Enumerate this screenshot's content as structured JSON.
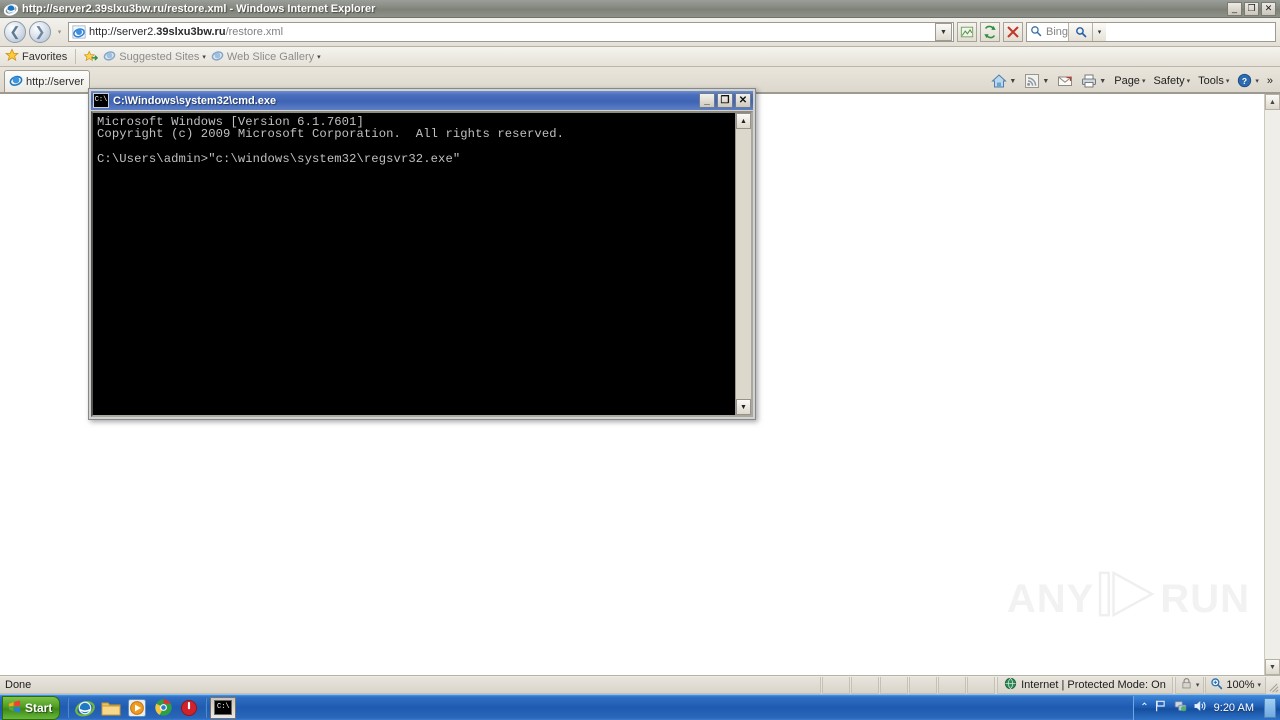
{
  "ie": {
    "window_title": "http://server2.39slxu3bw.ru/restore.xml - Windows Internet Explorer",
    "titlebar_buttons": {
      "minimize": "_",
      "restore": "❐",
      "close": "✕"
    },
    "address": {
      "url_prefix": "http://server2.",
      "url_host": "39slxu3bw.ru",
      "url_path": "/restore.xml",
      "full_url": "http://server2.39slxu3bw.ru/restore.xml"
    },
    "nav": {
      "back": "back-arrow",
      "forward": "forward-arrow",
      "recent_pages": "▾",
      "compatibility": "compatibility-view",
      "refresh": "refresh",
      "stop": "stop"
    },
    "search": {
      "placeholder": "Bing",
      "go_label": "Search",
      "dropdown": "▾"
    },
    "favorites_bar": {
      "favorites_label": "Favorites",
      "items": [
        {
          "label": "Suggested Sites",
          "caret": "▾"
        },
        {
          "label": "Web Slice Gallery",
          "caret": "▾"
        }
      ]
    },
    "tabs": [
      {
        "label": "http://server"
      }
    ],
    "command_bar": {
      "home": "home-icon",
      "feeds": "rss-icon",
      "mail": "mail-icon",
      "print": "print-icon",
      "items": [
        {
          "label": "Page",
          "caret": "▾"
        },
        {
          "label": "Safety",
          "caret": "▾"
        },
        {
          "label": "Tools",
          "caret": "▾"
        },
        {
          "label": "",
          "caret": "▾"
        }
      ],
      "overflow": "»"
    },
    "status_bar": {
      "text": "Done",
      "zone": "Internet | Protected Mode: On",
      "zoom": "100%",
      "zoom_caret": "▾",
      "lock_caret": "▾"
    },
    "watermark": {
      "left": "ANY",
      "right": "RUN"
    }
  },
  "cmd": {
    "title": "C:\\Windows\\system32\\cmd.exe",
    "icon_label": "C:\\",
    "buttons": {
      "minimize": "_",
      "maximize": "❐",
      "close": "✕"
    },
    "console_text": "Microsoft Windows [Version 6.1.7601]\nCopyright (c) 2009 Microsoft Corporation.  All rights reserved.\n\nC:\\Users\\admin>\"c:\\windows\\system32\\regsvr32.exe\"",
    "scroll_up": "▲",
    "scroll_down": "▼"
  },
  "taskbar": {
    "start_label": "Start",
    "quick_launch": [
      {
        "name": "internet-explorer"
      },
      {
        "name": "windows-explorer"
      },
      {
        "name": "media-player"
      },
      {
        "name": "google-chrome"
      },
      {
        "name": "shutdown-app"
      }
    ],
    "running": [
      {
        "name": "cmd-exe"
      }
    ],
    "tray": {
      "show_hidden": "⌃",
      "icons": [
        "flag-icon",
        "network-icon",
        "volume-icon"
      ],
      "clock": "9:20 AM"
    }
  }
}
